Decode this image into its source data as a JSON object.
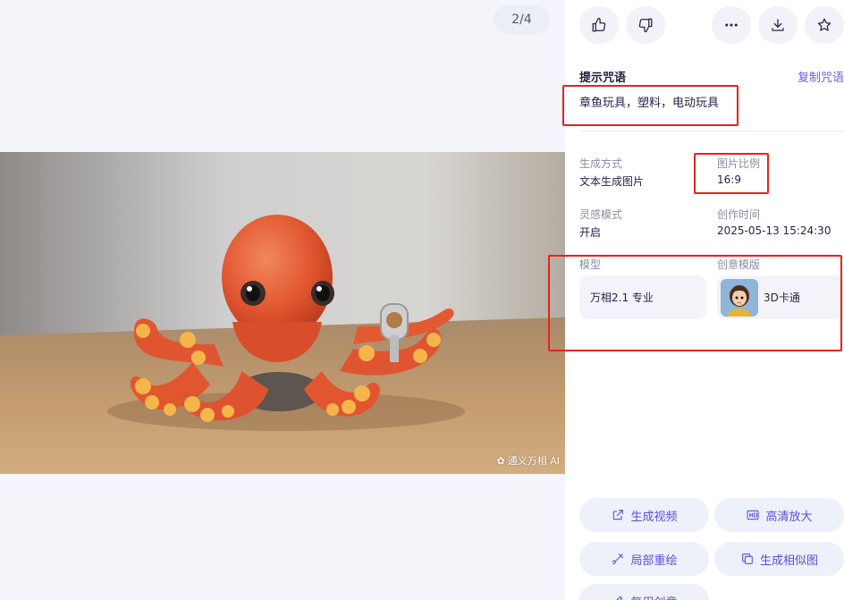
{
  "preview": {
    "counter": "2/4",
    "watermark": "通义万相 AI"
  },
  "toolbar": {
    "like_icon": "thumbs-up-icon",
    "dislike_icon": "thumbs-down-icon",
    "more_icon": "more-horizontal-icon",
    "download_icon": "download-icon",
    "favorite_icon": "star-icon"
  },
  "prompt": {
    "title": "提示咒语",
    "copy_label": "复制咒语",
    "text": "章鱼玩具，塑料，电动玩具"
  },
  "meta": {
    "mode_label": "生成方式",
    "mode_value": "文本生成图片",
    "ratio_label": "图片比例",
    "ratio_value": "16:9",
    "inspire_label": "灵感模式",
    "inspire_value": "开启",
    "time_label": "创作时间",
    "time_value": "2025-05-13 15:24:30",
    "model_label": "模型",
    "model_value": "万相2.1 专业",
    "template_label": "创意模版",
    "template_value": "3D卡通"
  },
  "actions": {
    "gen_video": "生成视频",
    "upscale": "高清放大",
    "inpaint": "局部重绘",
    "similar": "生成相似图",
    "reuse": "复用创意"
  },
  "colors": {
    "accent": "#6a5cf0",
    "annotation": "#e8221b"
  }
}
